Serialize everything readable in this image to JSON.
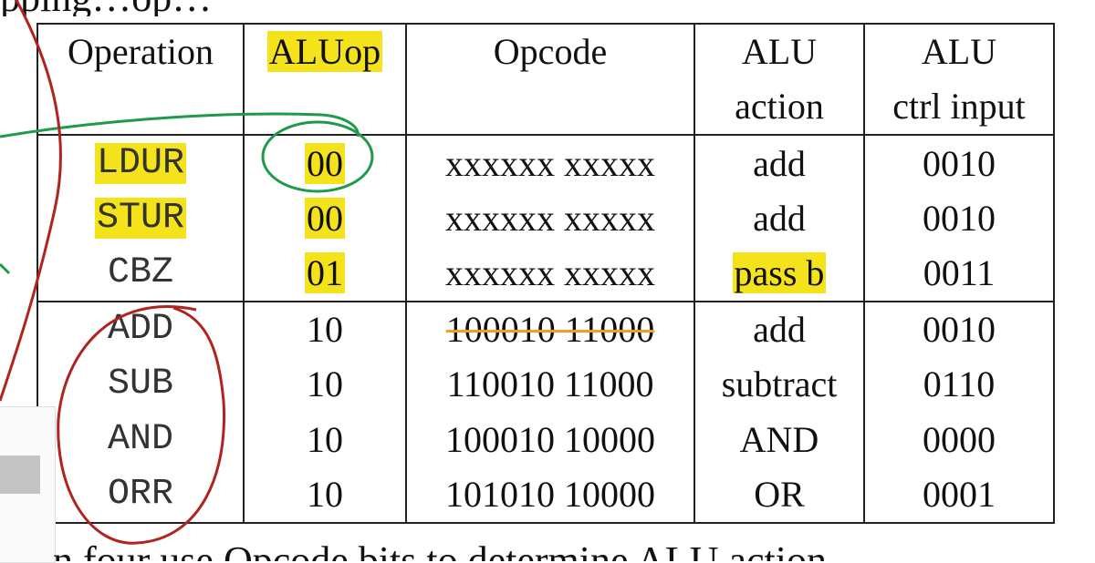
{
  "captions": {
    "top": "pping…op…",
    "bottom": "n four use Opcode bits to determine ALU action"
  },
  "table": {
    "headers": {
      "operation": "Operation",
      "aluop": "ALUop",
      "opcode": "Opcode",
      "alu_action_1": "ALU",
      "alu_action_2": "action",
      "alu_ctrl_1": "ALU",
      "alu_ctrl_2": "ctrl input"
    },
    "rows": [
      {
        "operation": "LDUR",
        "aluop": "00",
        "opcode": "xxxxxx xxxxx",
        "action": "add",
        "ctrl": "0010"
      },
      {
        "operation": "STUR",
        "aluop": "00",
        "opcode": "xxxxxx xxxxx",
        "action": "add",
        "ctrl": "0010"
      },
      {
        "operation": "CBZ",
        "aluop": "01",
        "opcode": "xxxxxx xxxxx",
        "action": "pass b",
        "ctrl": "0011"
      },
      {
        "operation": "ADD",
        "aluop": "10",
        "opcode": "100010 11000",
        "action": "add",
        "ctrl": "0010"
      },
      {
        "operation": "SUB",
        "aluop": "10",
        "opcode": "110010 11000",
        "action": "subtract",
        "ctrl": "0110"
      },
      {
        "operation": "AND",
        "aluop": "10",
        "opcode": "100010 10000",
        "action": "AND",
        "ctrl": "0000"
      },
      {
        "operation": "ORR",
        "aluop": "10",
        "opcode": "101010 10000",
        "action": "OR",
        "ctrl": "0001"
      }
    ]
  },
  "annotation_colors": {
    "highlight": "#f4e21a",
    "red_ink": "#b0241f",
    "green_ink": "#1e9a4a",
    "orange_strike": "#f0a020"
  }
}
